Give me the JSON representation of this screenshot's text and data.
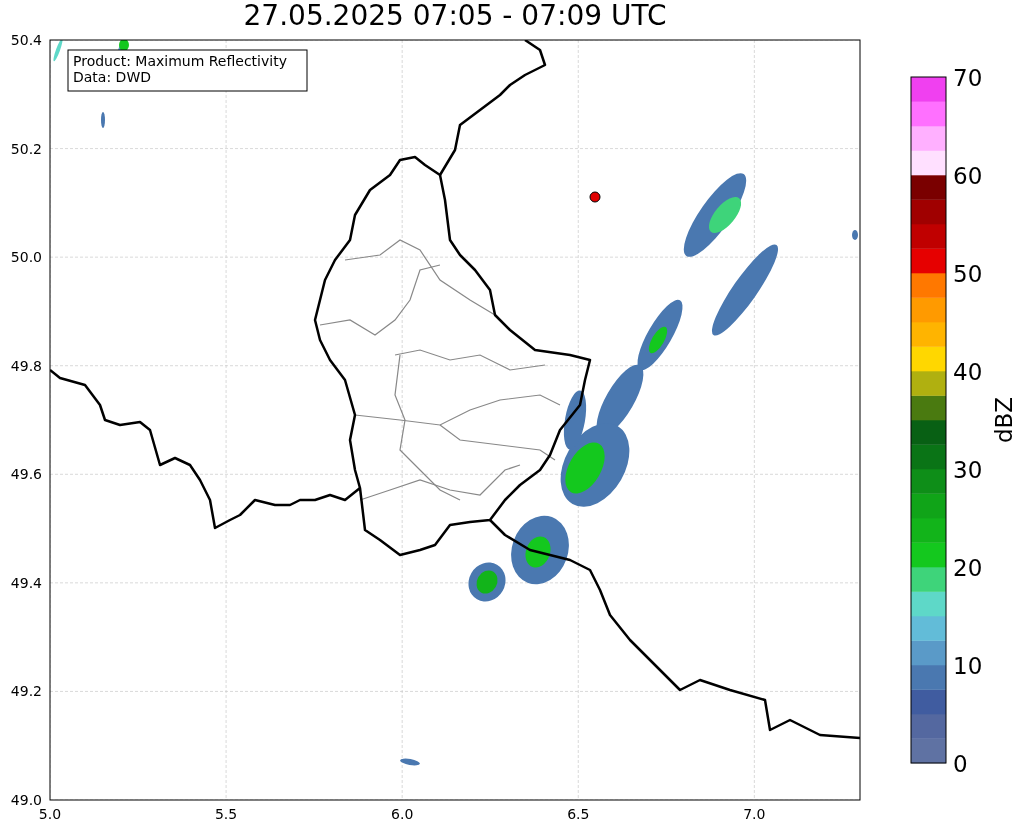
{
  "title": "27.05.2025 07:05 - 07:09 UTC",
  "map": {
    "info_lines": [
      "Product: Maximum Reflectivity",
      "Data: DWD"
    ],
    "xticks": [
      "5.0",
      "5.5",
      "6.0",
      "6.5",
      "7.0"
    ],
    "yticks": [
      "50.4",
      "50.2",
      "50.0",
      "49.8",
      "49.6",
      "49.4",
      "49.2",
      "49.0"
    ]
  },
  "colorbar": {
    "label": "dBZ",
    "ticks": [
      "70",
      "60",
      "50",
      "40",
      "30",
      "20",
      "10",
      "0"
    ],
    "segments": [
      {
        "color": "#5f72a3"
      },
      {
        "color": "#5468a0"
      },
      {
        "color": "#405ca0"
      },
      {
        "color": "#4a78b0"
      },
      {
        "color": "#5a9ac8"
      },
      {
        "color": "#62bcd8"
      },
      {
        "color": "#5ed8c8"
      },
      {
        "color": "#3ed47a"
      },
      {
        "color": "#14c81e"
      },
      {
        "color": "#12b41a"
      },
      {
        "color": "#10a418"
      },
      {
        "color": "#0e8e18"
      },
      {
        "color": "#0a7416"
      },
      {
        "color": "#086014"
      },
      {
        "color": "#4a7a10"
      },
      {
        "color": "#b0b010"
      },
      {
        "color": "#ffd700"
      },
      {
        "color": "#ffb400"
      },
      {
        "color": "#ff9a00"
      },
      {
        "color": "#ff7800"
      },
      {
        "color": "#e60000"
      },
      {
        "color": "#c00000"
      },
      {
        "color": "#a00000"
      },
      {
        "color": "#7a0000"
      },
      {
        "color": "#ffe0ff"
      },
      {
        "color": "#ffb0ff"
      },
      {
        "color": "#ff70ff"
      },
      {
        "color": "#f040f0"
      }
    ]
  }
}
